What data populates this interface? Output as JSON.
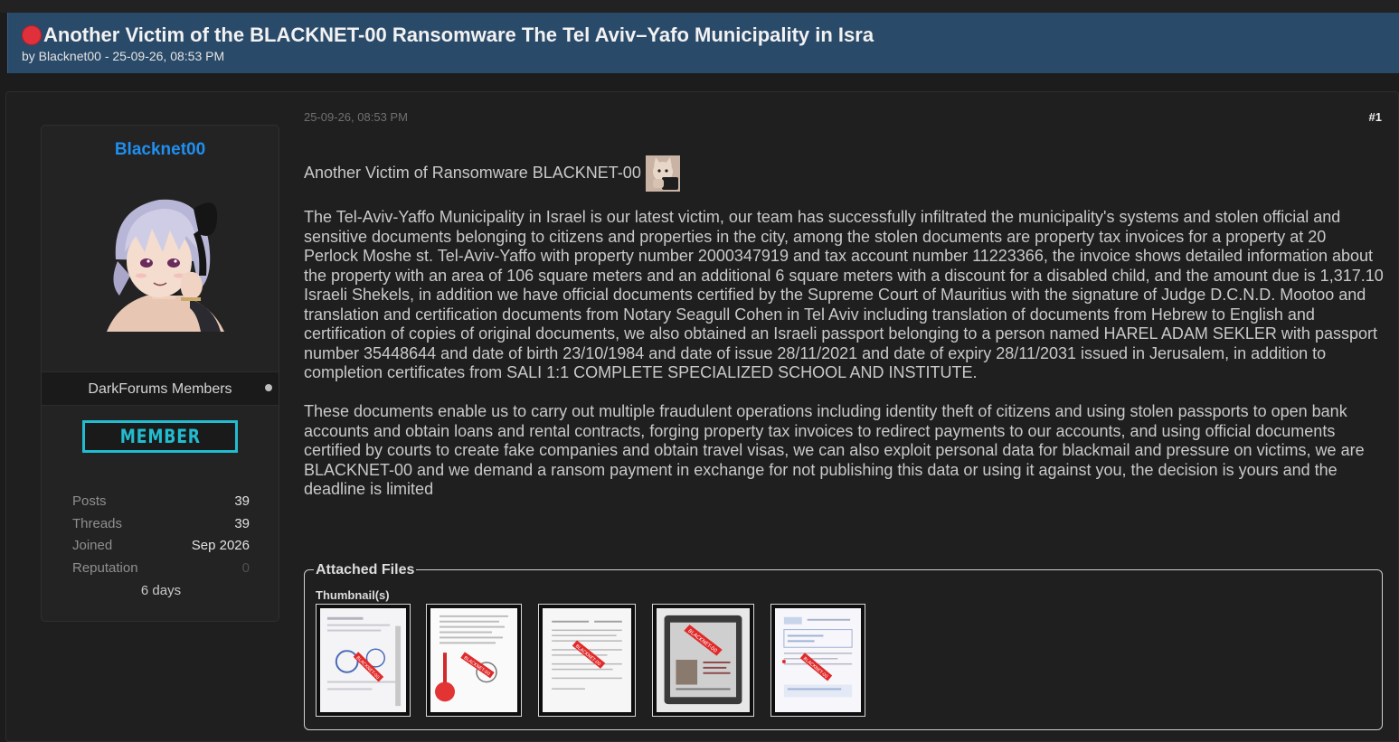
{
  "thread": {
    "title": "Another Victim of the BLACKNET-00 Ransomware The Tel Aviv–Yafo Municipality in Isra",
    "byline": "by Blacknet00 - 25-09-26, 08:53 PM",
    "status_color": "#e0303b"
  },
  "author": {
    "name": "Blacknet00",
    "group": "DarkForums Members",
    "rank": "MEMBER",
    "stats": [
      {
        "label": "Posts",
        "value": "39"
      },
      {
        "label": "Threads",
        "value": "39"
      },
      {
        "label": "Joined",
        "value": "Sep 2026"
      },
      {
        "label": "Reputation",
        "value": "0"
      }
    ],
    "extra": "6 days"
  },
  "post": {
    "date": "25-09-26, 08:53 PM",
    "number": "#1",
    "intro": "Another Victim of Ransomware BLACKNET-00",
    "paragraph1": "The Tel-Aviv-Yaffo Municipality in Israel is our latest victim, our team has successfully infiltrated the municipality's systems and stolen official and sensitive documents belonging to citizens and properties in the city, among the stolen documents are property tax invoices for a property at 20 Perlock Moshe st. Tel-Aviv-Yaffo with property number 2000347919 and tax account number 11223366, the invoice shows detailed information about the property with an area of 106 square meters and an additional 6 square meters with a discount for a disabled child, and the amount due is 1,317.10 Israeli Shekels, in addition we have official documents certified by the Supreme Court of Mauritius with the signature of Judge D.C.N.D. Mootoo and translation and certification documents from Notary Seagull Cohen in Tel Aviv including translation of documents from Hebrew to English and certification of copies of original documents, we also obtained an Israeli passport belonging to a person named HAREL ADAM SEKLER with passport number 35448644 and date of birth 23/10/1984 and date of issue 28/11/2021 and date of expiry 28/11/2031 issued in Jerusalem, in addition to completion certificates from SALI 1:1 COMPLETE SPECIALIZED SCHOOL AND INSTITUTE.",
    "paragraph2": "These documents enable us to carry out multiple fraudulent operations including identity theft of citizens and using stolen passports to open bank accounts and obtain loans and rental contracts, forging property tax invoices to redirect payments to our accounts, and using official documents certified by courts to create fake companies and obtain travel visas, we can also exploit personal data for blackmail and pressure on victims, we are BLACKNET-00 and we demand a ransom payment in exchange for not publishing this data or using it against you, the decision is yours and the deadline is limited"
  },
  "attachments": {
    "legend": "Attached Files",
    "thumbnails_label": "Thumbnail(s)",
    "stamp_text": "BLACKNET-00",
    "thumbnails": [
      {
        "kind": "document-seal"
      },
      {
        "kind": "document-wax-seal"
      },
      {
        "kind": "document-form"
      },
      {
        "kind": "passport-photo"
      },
      {
        "kind": "document-table"
      }
    ]
  }
}
